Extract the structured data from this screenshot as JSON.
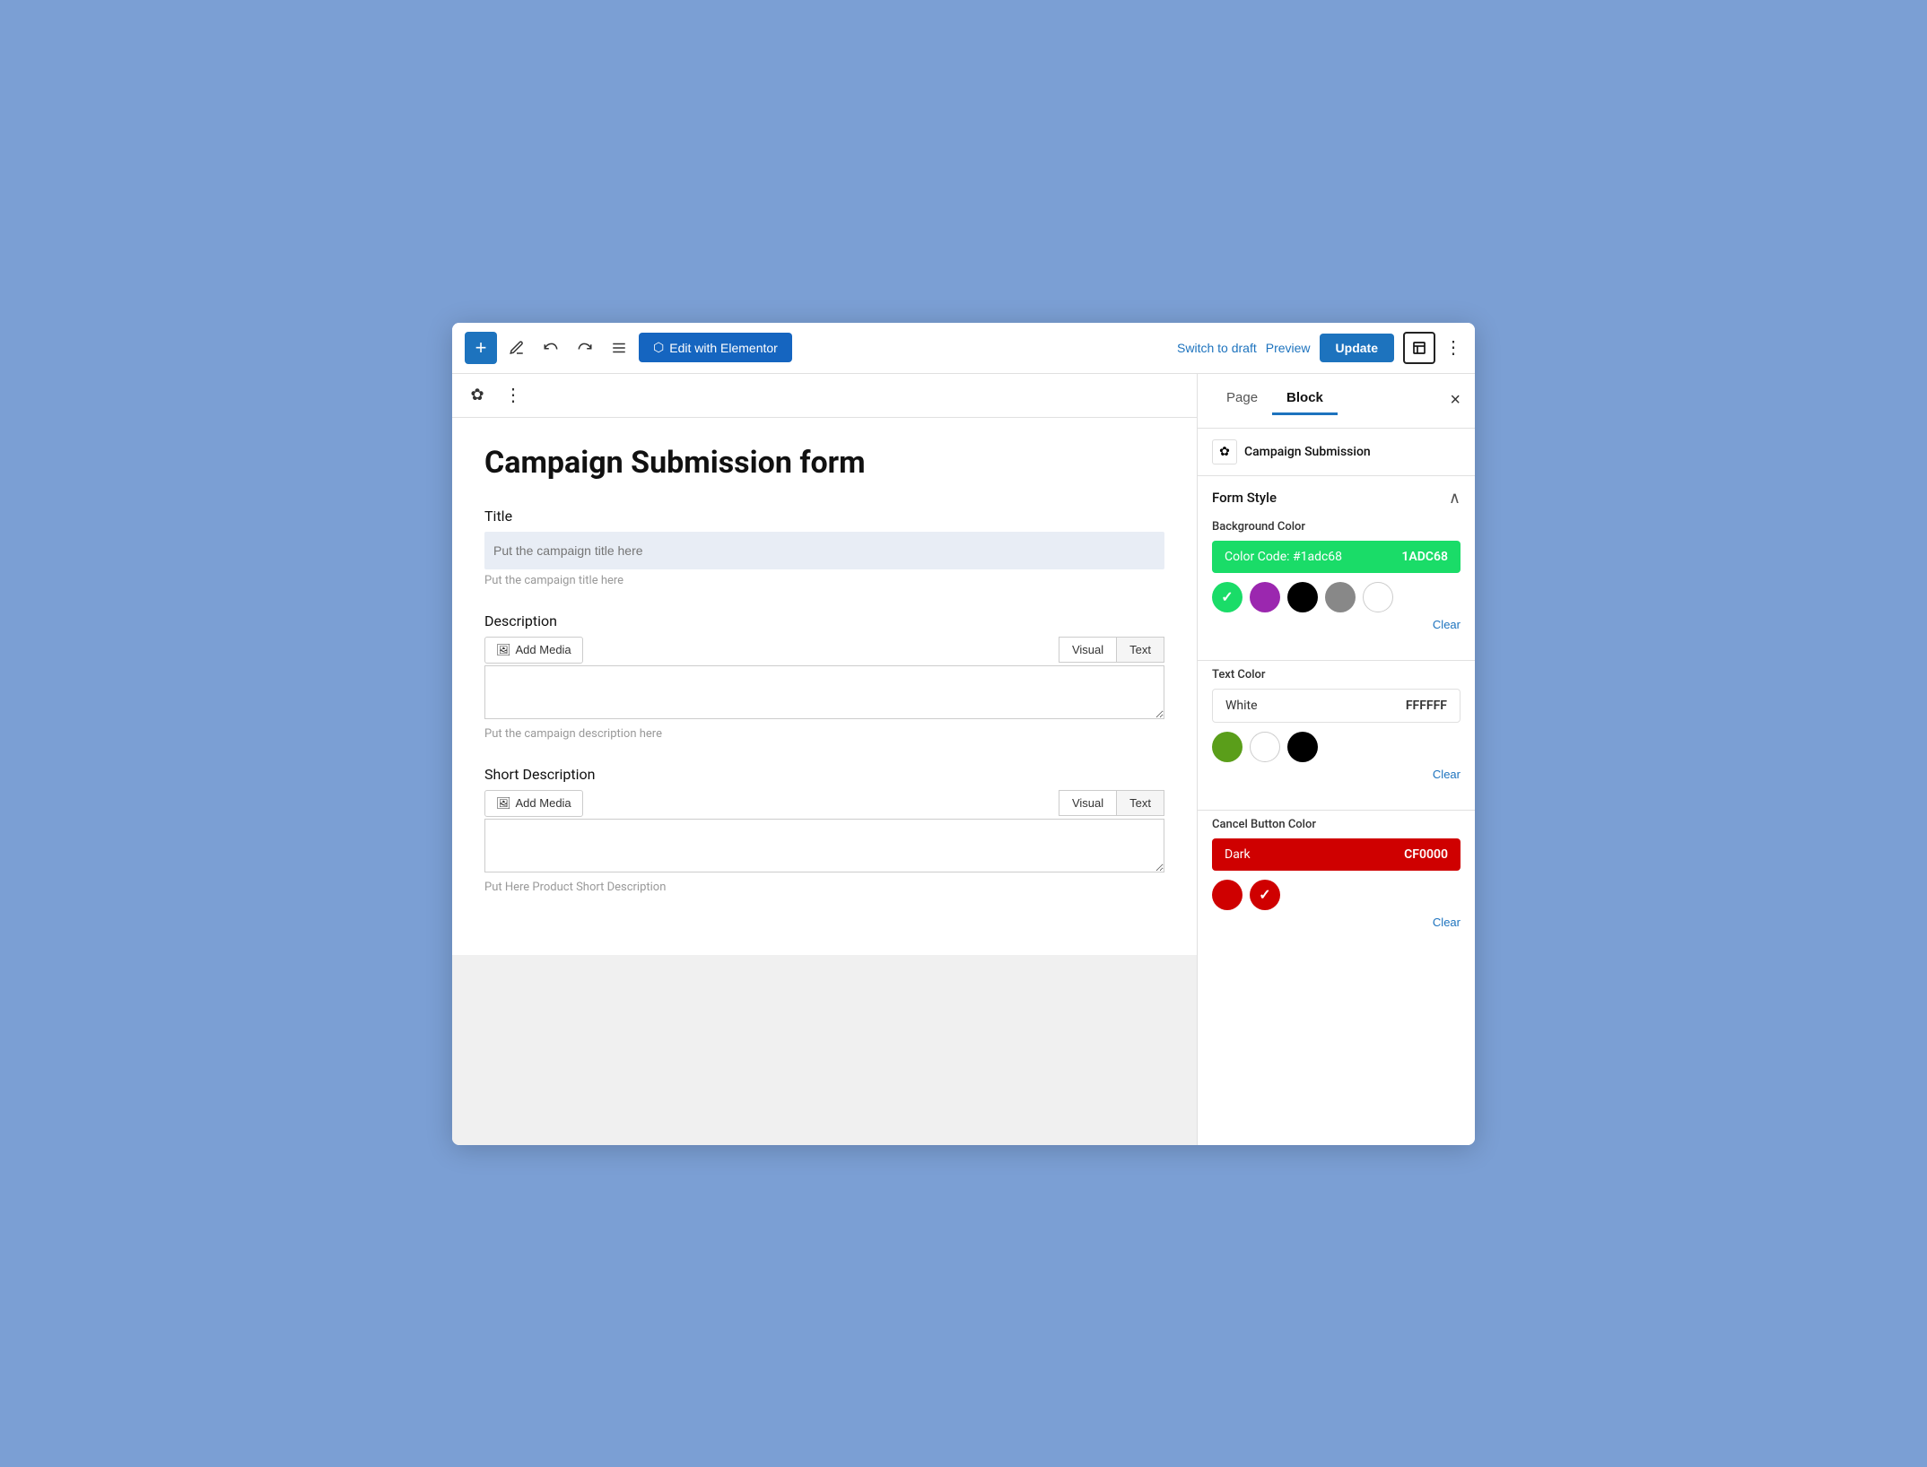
{
  "topBar": {
    "addLabel": "+",
    "editElementorLabel": "Edit with Elementor",
    "switchToDraftLabel": "Switch to draft",
    "previewLabel": "Preview",
    "updateLabel": "Update",
    "moreOptionsLabel": "⋮"
  },
  "editor": {
    "formTitle": "Campaign Submission form",
    "fields": [
      {
        "label": "Title",
        "inputPlaceholder": "",
        "hint": "Put the campaign title here"
      },
      {
        "label": "Description",
        "visualTab": "Visual",
        "textTab": "Text",
        "hint": "Put the campaign description here"
      },
      {
        "label": "Short Description",
        "visualTab": "Visual",
        "textTab": "Text",
        "hint": "Put Here Product Short Description"
      }
    ],
    "addMediaLabel": "Add Media"
  },
  "sidebar": {
    "pageTabLabel": "Page",
    "blockTabLabel": "Block",
    "activeTab": "Block",
    "blockName": "Campaign Submission",
    "formStyleLabel": "Form Style",
    "sections": {
      "backgroundColor": {
        "label": "Background Color",
        "colorCode": "Color Code: #1adc68",
        "colorHex": "1ADC68",
        "swatches": [
          {
            "color": "#1adc68",
            "selected": true,
            "label": "green-swatch"
          },
          {
            "color": "#9b27af",
            "selected": false,
            "label": "purple-swatch"
          },
          {
            "color": "#000000",
            "selected": false,
            "label": "black-swatch"
          },
          {
            "color": "#888888",
            "selected": false,
            "label": "gray-swatch"
          },
          {
            "color": "#ffffff",
            "selected": false,
            "border": true,
            "label": "white-swatch"
          }
        ],
        "clearLabel": "Clear"
      },
      "textColor": {
        "label": "Text Color",
        "colorName": "White",
        "colorHex": "FFFFFF",
        "swatches": [
          {
            "color": "#5a9e1a",
            "selected": false,
            "label": "olive-swatch"
          },
          {
            "color": "#ffffff",
            "selected": false,
            "border": true,
            "label": "white-swatch2"
          },
          {
            "color": "#000000",
            "selected": false,
            "label": "black-swatch2"
          }
        ],
        "clearLabel": "Clear"
      },
      "cancelButtonColor": {
        "label": "Cancel Button Color",
        "colorName": "Dark",
        "colorHex": "CF0000",
        "swatches": [
          {
            "color": "#cf0000",
            "selected": false,
            "label": "red-swatch"
          },
          {
            "color": "#cf0000",
            "selected": true,
            "label": "red-selected-swatch"
          }
        ],
        "clearLabel": "Clear"
      }
    }
  }
}
